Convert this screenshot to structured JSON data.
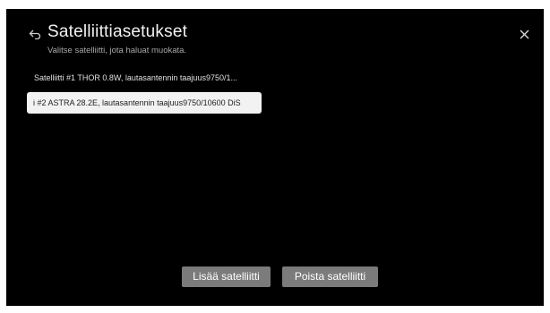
{
  "header": {
    "title": "Satelliittiasetukset",
    "subtitle": "Valitse satelliitti, jota haluat muokata.",
    "back_icon": "back-arrow-icon",
    "close_icon": "close-icon"
  },
  "satellites": [
    {
      "label": "Satelliitti #1 THOR 0.8W, lautasantennin taajuus9750/1..."
    },
    {
      "label": "i #2 ASTRA 28.2E, lautasantennin taajuus9750/10600 DiS"
    }
  ],
  "buttons": {
    "add_label": "Lisää satelliitti",
    "remove_label": "Poista satelliitti"
  },
  "colors": {
    "background": "#000000",
    "focus": "#f2f2f2",
    "button": "#7b7b7b"
  }
}
